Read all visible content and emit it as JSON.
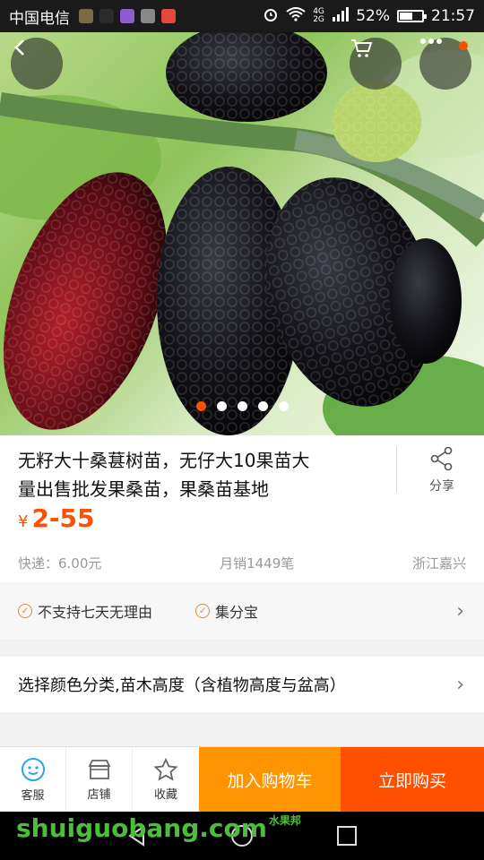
{
  "status": {
    "carrier": "中国电信",
    "app_icons": [
      "#7a6a4a",
      "#2b2b2b",
      "#8e5bd1",
      "#888888",
      "#e5483c"
    ],
    "network": "4G 2G",
    "battery": "52%",
    "battery_level": 0.52,
    "time": "21:57"
  },
  "gallery": {
    "image_count": 5,
    "active_index": 0,
    "icons": [
      "back-arrow",
      "cart",
      "more"
    ]
  },
  "product": {
    "title_line1": "无籽大十桑葚树苗，无仔大10果苗大",
    "title_line2": "量出售批发果桑苗，果桑苗基地",
    "share_label": "分享",
    "currency": "¥",
    "price": "2-55",
    "shipping": "快递：6.00元",
    "monthly_sales": "月销1449笔",
    "location": "浙江嘉兴"
  },
  "service": {
    "items": [
      "不支持七天无理由",
      "集分宝"
    ]
  },
  "spec": {
    "label": "选择颜色分类,苗木高度（含植物高度与盆高）"
  },
  "tabbar": {
    "customer_service": "客服",
    "shop": "店铺",
    "favorite": "收藏",
    "add_to_cart": "加入购物车",
    "buy_now": "立即购买"
  },
  "watermark": {
    "text": "shuiguobang.com",
    "cn": "水果邦"
  },
  "colors": {
    "accent": "#ff5000",
    "cart_button": "#ff9402",
    "status_bar": "#1a1a1a"
  }
}
